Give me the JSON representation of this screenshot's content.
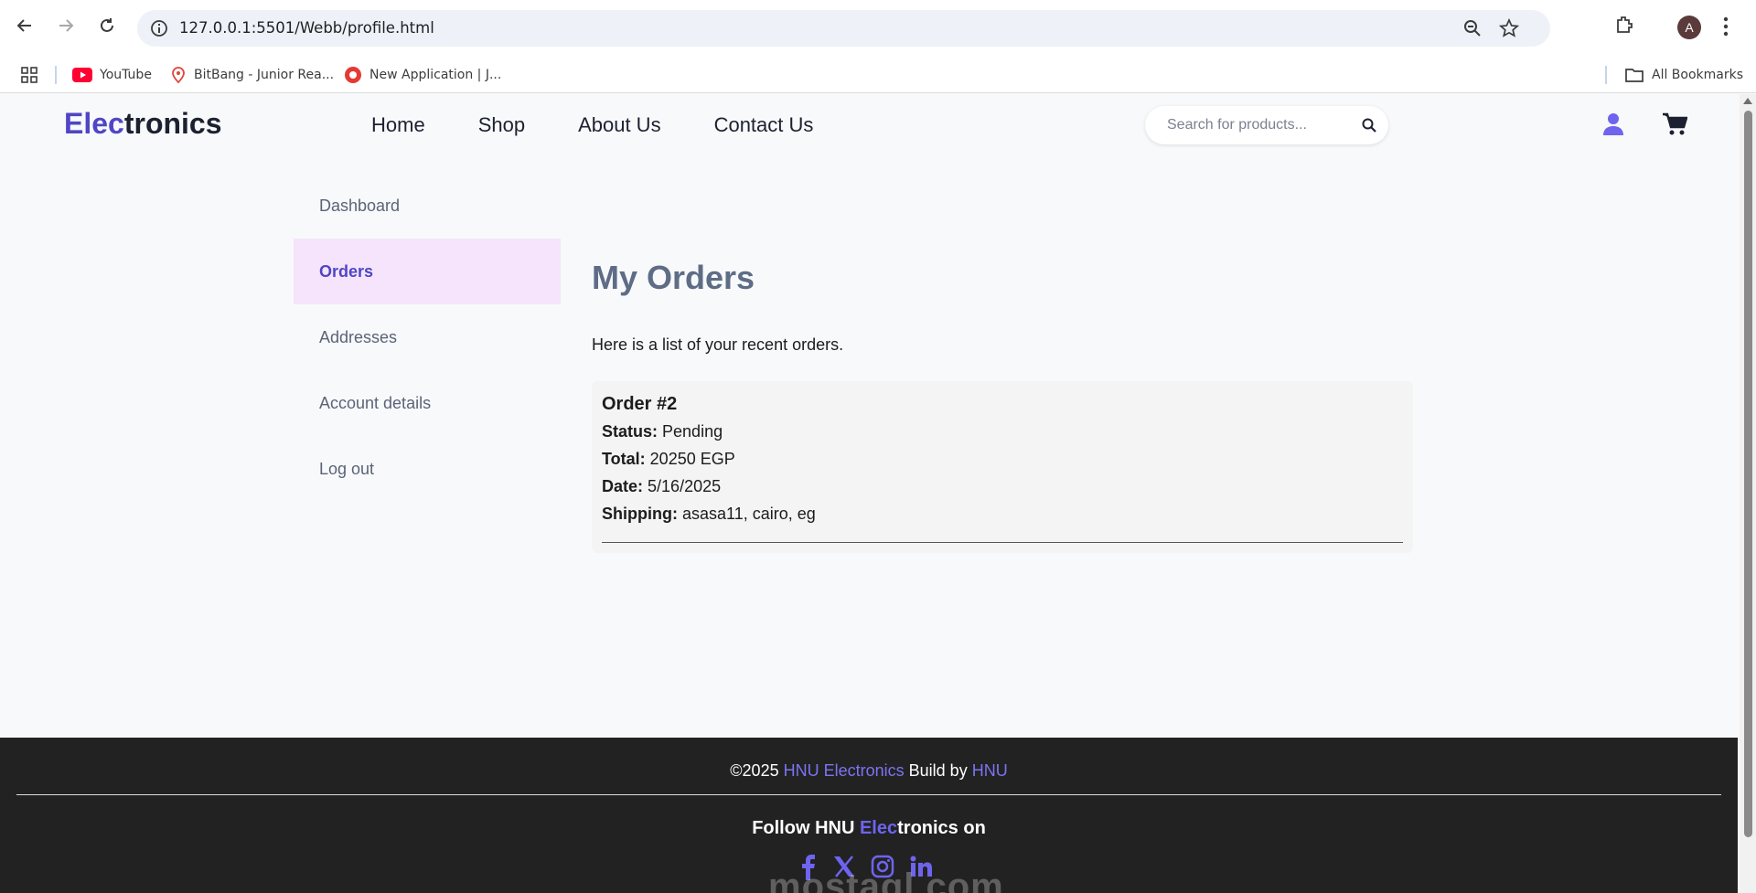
{
  "browser": {
    "url": "127.0.0.1:5501/Webb/profile.html",
    "profile_initial": "A",
    "bookmarks": [
      {
        "label": "YouTube",
        "icon": "youtube-icon"
      },
      {
        "label": "BitBang - Junior Rea...",
        "icon": "bitbang-icon"
      },
      {
        "label": "New Application | J...",
        "icon": "record-icon"
      }
    ],
    "all_bookmarks_label": "All Bookmarks"
  },
  "site": {
    "logo_accent": "Elec",
    "logo_rest": "tronics",
    "nav": [
      "Home",
      "Shop",
      "About Us",
      "Contact Us"
    ],
    "search_placeholder": "Search for products..."
  },
  "sidebar": {
    "items": [
      "Dashboard",
      "Orders",
      "Addresses",
      "Account details",
      "Log out"
    ],
    "active": "Orders"
  },
  "main": {
    "title": "My Orders",
    "intro": "Here is a list of your recent orders.",
    "order": {
      "title": "Order #2",
      "status_label": "Status:",
      "status": "Pending",
      "total_label": "Total:",
      "total": "20250 EGP",
      "date_label": "Date:",
      "date": "5/16/2025",
      "shipping_label": "Shipping:",
      "shipping": "asasa11, cairo, eg"
    }
  },
  "footer": {
    "copy_prefix": "©2025",
    "copy_brand": "HNU Electronics",
    "copy_mid": "Build by",
    "copy_author": "HNU",
    "follow_prefix": "Follow HNU",
    "follow_accent": "Elec",
    "follow_suffix": "tronics on",
    "socials": [
      "facebook-icon",
      "x-icon",
      "instagram-icon",
      "linkedin-icon"
    ]
  },
  "watermark": "mostaql.com",
  "colors": {
    "accent": "#4f46c5",
    "active_bg": "#f5e4fb",
    "footer_bg": "#222222",
    "social": "#6e64ee"
  }
}
